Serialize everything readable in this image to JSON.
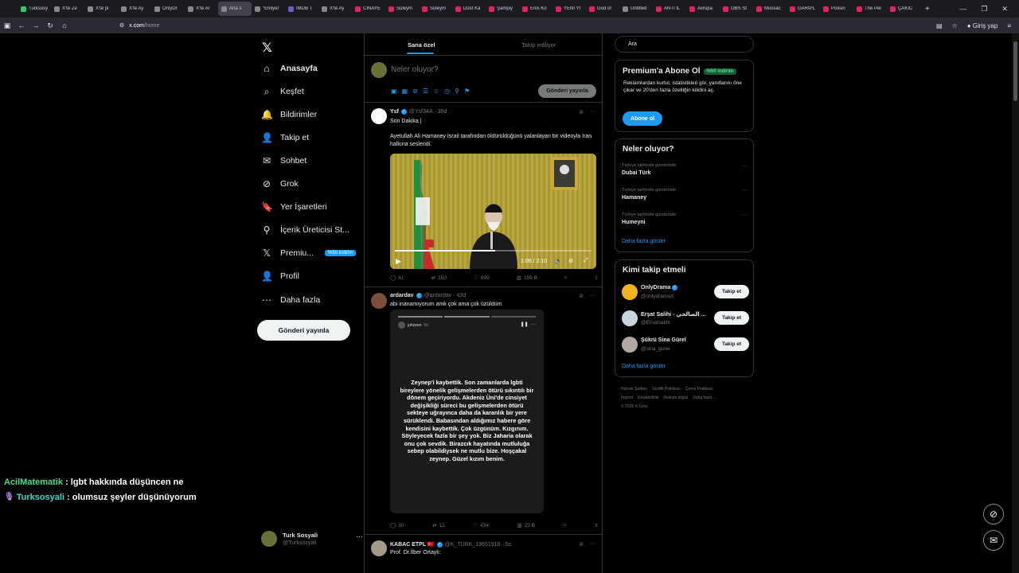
{
  "browser": {
    "tabs": [
      {
        "title": "Turksosyali",
        "color": "#2ecc71",
        "active": false
      },
      {
        "title": "X'te Ze",
        "color": "#888",
        "active": false
      },
      {
        "title": "X'te pi",
        "color": "#888",
        "active": false
      },
      {
        "title": "X'te Ay",
        "color": "#888",
        "active": false
      },
      {
        "title": "OnlyDr",
        "color": "#888",
        "active": false
      },
      {
        "title": "X'te Ar",
        "color": "#888",
        "active": false
      },
      {
        "title": "Ana s",
        "color": "#888",
        "active": true
      },
      {
        "title": "\"Ehliyet",
        "color": "#888",
        "active": false
      },
      {
        "title": "IMDB T",
        "color": "#6a5acd",
        "active": false
      },
      {
        "title": "X'te Ay",
        "color": "#888",
        "active": false
      },
      {
        "title": "CINAYE",
        "color": "#e0245e",
        "active": false
      },
      {
        "title": "Süleym",
        "color": "#e0245e",
        "active": false
      },
      {
        "title": "Süleym",
        "color": "#e0245e",
        "active": false
      },
      {
        "title": "Dost Ka",
        "color": "#e0245e",
        "active": false
      },
      {
        "title": "Şampiy",
        "color": "#e0245e",
        "active": false
      },
      {
        "title": "Enis Kö",
        "color": "#e0245e",
        "active": false
      },
      {
        "title": "YENİ Yİ",
        "color": "#e0245e",
        "active": false
      },
      {
        "title": "God of",
        "color": "#e0245e",
        "active": false
      },
      {
        "title": "Untitled",
        "color": "#888",
        "active": false
      },
      {
        "title": "ANTI İL",
        "color": "#e0245e",
        "active": false
      },
      {
        "title": "Avrupa",
        "color": "#e0245e",
        "active": false
      },
      {
        "title": "OBS St",
        "color": "#e0245e",
        "active": false
      },
      {
        "title": "Mossac",
        "color": "#e0245e",
        "active": false
      },
      {
        "title": "GARIPL",
        "color": "#e0245e",
        "active": false
      },
      {
        "title": "Polisin",
        "color": "#e0245e",
        "active": false
      },
      {
        "title": "The Pel",
        "color": "#e0245e",
        "active": false
      },
      {
        "title": "ÇAKIC",
        "color": "#e0245e",
        "active": false
      }
    ],
    "new_tab": "+",
    "url_host": "x.com",
    "url_path": "/home",
    "login_label": "Giriş yap"
  },
  "sidebar": {
    "logo": "𝕏",
    "items": [
      {
        "label": "Anasayfa",
        "icon": "⌂",
        "bold": true
      },
      {
        "label": "Keşfet",
        "icon": "⌕",
        "bold": false
      },
      {
        "label": "Bildirimler",
        "icon": "🔔",
        "bold": false
      },
      {
        "label": "Takip et",
        "icon": "👤",
        "bold": false
      },
      {
        "label": "Sohbet",
        "icon": "✉",
        "bold": false
      },
      {
        "label": "Grok",
        "icon": "⊘",
        "bold": false
      },
      {
        "label": "Yer İşaretleri",
        "icon": "🔖",
        "bold": false
      },
      {
        "label": "İçerik Üreticisi St...",
        "icon": "⚲",
        "bold": false
      },
      {
        "label": "Premiu...",
        "icon": "𝕏",
        "bold": false,
        "badge": "%50 indirim"
      },
      {
        "label": "Profil",
        "icon": "👤",
        "bold": false
      },
      {
        "label": "Daha fazla",
        "icon": "⋯",
        "bold": false
      }
    ],
    "post_button": "Gönderi yayınla",
    "account": {
      "name": "Turk Sosyali",
      "handle": "@Turksosyali",
      "more": "···"
    }
  },
  "main": {
    "tabs": {
      "for_you": "Sana özel",
      "following": "Takip ediliyor"
    },
    "composer": {
      "placeholder": "Neler oluyor?",
      "post_button": "Gönderi yayınla"
    },
    "tweets": [
      {
        "name": "Ysf",
        "handle": "@Ysf34A · 38d",
        "line1": "Son Dakika |",
        "line2": "Ayetullah Ali Hamaney İsrail tarafından öldürüldüğünü yalanlayan bir videoyla İran halkına seslendi.",
        "video_time": "1:06 / 2:10",
        "video_progress": 0.51,
        "replies": "61",
        "reposts": "150",
        "likes": "899",
        "views": "109 B"
      },
      {
        "name": "ardardav",
        "handle": "@ardardav · 43d",
        "line1": "abi inanamıyorum amk çok ama çok üzüldüm",
        "story_user": "juhzeen",
        "story_time": "5d",
        "story_text": "Zeynep'i kaybettik. Son zamanlarda lgbti bireylere yönelik gelişmelerden ötürü sıkıntılı bir dönem geçiriyordu. Akdeniz Üni'de cinsiyet değişikliği süreci bu gelişmelerden ötürü sekteye uğrayınca daha da karanlık bir yere sürüklendi. Babasından aldığımız habere göre kendisini kaybettik. Çok üzgünüm. Kızgınım. Söyleyecek fazla bir şey yok. Biz Jaharia olarak onu çok sevdik. Birazcık hayatında mutluluğa sebep olabildiysek ne mutlu bize. Hoşçakal zeynep. Güzel kızım benim.",
        "replies": "30",
        "reposts": "12",
        "likes": "434",
        "views": "23 B"
      },
      {
        "name": "KABAC ETPL 🇹🇷",
        "handle": "@K_TURK_19651919 · 5s",
        "line1": "Prof. Dr.İlber Ortaylı:"
      }
    ]
  },
  "right": {
    "search_placeholder": "Ara",
    "premium": {
      "title": "Premium'a Abone Ol",
      "badge": "%50 indirim",
      "body": "Reklamlardan kurtul, istatistikleri gör, yanıtlarını öne çıkar ve 20'den fazla özelliğin kilidini aç.",
      "button": "Abone ol"
    },
    "trends": {
      "title": "Neler oluyor?",
      "items": [
        {
          "context": "Türkiye tarihinde gündemde",
          "term": "Dubai Türk"
        },
        {
          "context": "Türkiye tarihinde gündemde",
          "term": "Hamaney"
        },
        {
          "context": "Türkiye tarihinde gündemde",
          "term": "Humeyni"
        }
      ],
      "show_more": "Daha fazla göster"
    },
    "who_to_follow": {
      "title": "Kimi takip etmeli",
      "items": [
        {
          "name": "OnlyDrama",
          "handle": "@onlydramaX",
          "verified": true,
          "color": "#f0b323",
          "button": "Takip et"
        },
        {
          "name": "Erşat Salihi - الصالحي ...",
          "handle": "@Ersatsalihi",
          "verified": false,
          "color": "#c8d4e0",
          "button": "Takip et"
        },
        {
          "name": "Şükrü Sina Gürel",
          "handle": "@sina_gurel",
          "verified": false,
          "color": "#b0a9a0",
          "button": "Takip et"
        }
      ],
      "show_more": "Daha fazla göster"
    },
    "footer": [
      "Hizmet Şartları",
      "Gizlilik Politikası",
      "Çerez Politikası",
      "İmprint",
      "Erişilebilirlik",
      "Reklam bilgisi",
      "Daha fazla ...",
      "© 2026 X Corp."
    ]
  },
  "chat": [
    {
      "user": "AcilMatematik",
      "message": ": lgbt hakkında düşüncen ne"
    },
    {
      "user": "Turksosyali",
      "message": ": olumsuz şeyler düşünüyorum"
    }
  ]
}
